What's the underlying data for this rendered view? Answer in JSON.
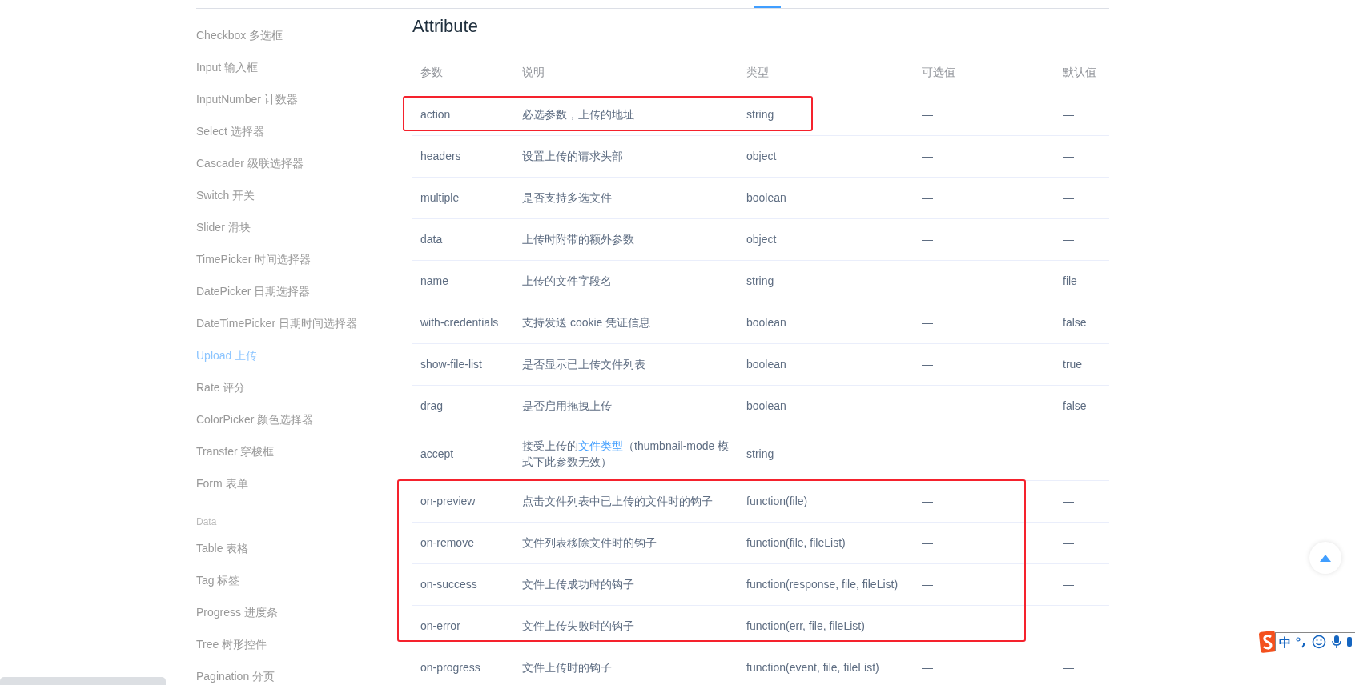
{
  "sidebar": {
    "items": [
      {
        "kind": "item",
        "label": "Checkbox 多选框",
        "selected": false
      },
      {
        "kind": "item",
        "label": "Input 输入框",
        "selected": false
      },
      {
        "kind": "item",
        "label": "InputNumber 计数器",
        "selected": false
      },
      {
        "kind": "item",
        "label": "Select 选择器",
        "selected": false
      },
      {
        "kind": "item",
        "label": "Cascader 级联选择器",
        "selected": false
      },
      {
        "kind": "item",
        "label": "Switch 开关",
        "selected": false
      },
      {
        "kind": "item",
        "label": "Slider 滑块",
        "selected": false
      },
      {
        "kind": "item",
        "label": "TimePicker 时间选择器",
        "selected": false
      },
      {
        "kind": "item",
        "label": "DatePicker 日期选择器",
        "selected": false
      },
      {
        "kind": "item",
        "label": "DateTimePicker 日期时间选择器",
        "selected": false
      },
      {
        "kind": "item",
        "label": "Upload 上传",
        "selected": true
      },
      {
        "kind": "item",
        "label": "Rate 评分",
        "selected": false
      },
      {
        "kind": "item",
        "label": "ColorPicker 颜色选择器",
        "selected": false
      },
      {
        "kind": "item",
        "label": "Transfer 穿梭框",
        "selected": false
      },
      {
        "kind": "item",
        "label": "Form 表单",
        "selected": false
      },
      {
        "kind": "group",
        "label": "Data"
      },
      {
        "kind": "item",
        "label": "Table 表格",
        "selected": false
      },
      {
        "kind": "item",
        "label": "Tag 标签",
        "selected": false
      },
      {
        "kind": "item",
        "label": "Progress 进度条",
        "selected": false
      },
      {
        "kind": "item",
        "label": "Tree 树形控件",
        "selected": false
      },
      {
        "kind": "item",
        "label": "Pagination 分页",
        "selected": false
      }
    ]
  },
  "section_title": "Attribute",
  "table": {
    "columns": [
      "参数",
      "说明",
      "类型",
      "可选值",
      "默认值"
    ],
    "rows": [
      {
        "name": "action",
        "description": [
          {
            "text": "必选参数，上传的地址"
          }
        ],
        "type": "string",
        "options": "—",
        "default": "—",
        "kind": "narrow"
      },
      {
        "name": "headers",
        "description": [
          {
            "text": "设置上传的请求头部"
          }
        ],
        "type": "object",
        "options": "—",
        "default": "—"
      },
      {
        "name": "multiple",
        "description": [
          {
            "text": "是否支持多选文件"
          }
        ],
        "type": "boolean",
        "options": "—",
        "default": "—"
      },
      {
        "name": "data",
        "description": [
          {
            "text": "上传时附带的额外参数"
          }
        ],
        "type": "object",
        "options": "—",
        "default": "—"
      },
      {
        "name": "name",
        "description": [
          {
            "text": "上传的文件字段名"
          }
        ],
        "type": "string",
        "options": "—",
        "default": "file"
      },
      {
        "name": "with-credentials",
        "description": [
          {
            "text": "支持发送 cookie 凭证信息"
          }
        ],
        "type": "boolean",
        "options": "—",
        "default": "false"
      },
      {
        "name": "show-file-list",
        "description": [
          {
            "text": "是否显示已上传文件列表"
          }
        ],
        "type": "boolean",
        "options": "—",
        "default": "true"
      },
      {
        "name": "drag",
        "description": [
          {
            "text": "是否启用拖拽上传"
          }
        ],
        "type": "boolean",
        "options": "—",
        "default": "false"
      },
      {
        "name": "accept",
        "description": [
          {
            "text": "接受上传的"
          },
          {
            "text": "文件类型",
            "link": true
          },
          {
            "text": "（thumbnail-mode 模式下此参数无效）"
          }
        ],
        "type": "string",
        "options": "—",
        "default": "—"
      },
      {
        "name": "on-preview",
        "description": [
          {
            "text": "点击文件列表中已上传的文件时的钩子"
          }
        ],
        "type": "function(file)",
        "options": "—",
        "default": "—",
        "kind": "wide"
      },
      {
        "name": "on-remove",
        "description": [
          {
            "text": "文件列表移除文件时的钩子"
          }
        ],
        "type": "function(file, fileList)",
        "options": "—",
        "default": "—",
        "kind": "wide"
      },
      {
        "name": "on-success",
        "description": [
          {
            "text": "文件上传成功时的钩子"
          }
        ],
        "type": "function(response, file, fileList)",
        "options": "—",
        "default": "—",
        "kind": "wide"
      },
      {
        "name": "on-error",
        "description": [
          {
            "text": "文件上传失败时的钩子"
          }
        ],
        "type": "function(err, file, fileList)",
        "options": "—",
        "default": "—",
        "kind": "wide"
      },
      {
        "name": "on-progress",
        "description": [
          {
            "text": "文件上传时的钩子"
          }
        ],
        "type": "function(event, file, fileList)",
        "options": "—",
        "default": "—"
      }
    ]
  },
  "ime_toolbar": {
    "mode": "中"
  }
}
